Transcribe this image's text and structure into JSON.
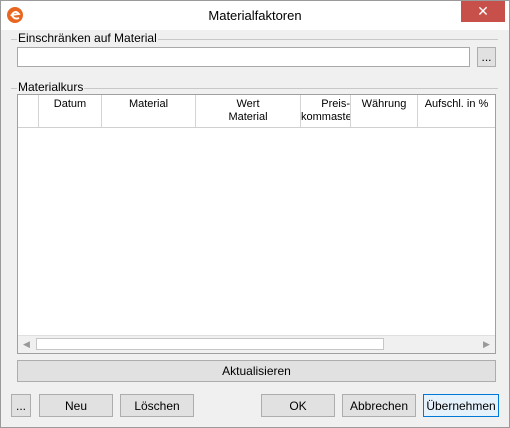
{
  "window": {
    "title": "Materialfaktoren",
    "close_glyph": "✕"
  },
  "filter": {
    "group_label": "Einschränken auf Material",
    "value": "",
    "browse_label": "..."
  },
  "grid": {
    "group_label": "Materialkurs",
    "columns": [
      {
        "label": ""
      },
      {
        "label": "Datum"
      },
      {
        "label": "Material"
      },
      {
        "label": "Wert\nMaterial"
      },
      {
        "label": "Preis-\nkommastellen"
      },
      {
        "label": "Währung"
      },
      {
        "label": "Aufschl. in %"
      }
    ],
    "rows": [],
    "scroll_left_glyph": "◀",
    "scroll_right_glyph": "▶"
  },
  "buttons": {
    "refresh": "Aktualisieren",
    "more": "...",
    "new": "Neu",
    "delete": "Löschen",
    "ok": "OK",
    "cancel": "Abbrechen",
    "apply": "Übernehmen"
  },
  "colors": {
    "close_bg": "#c7504a",
    "app_icon": "#e8661f",
    "primary_border": "#0078d7"
  }
}
